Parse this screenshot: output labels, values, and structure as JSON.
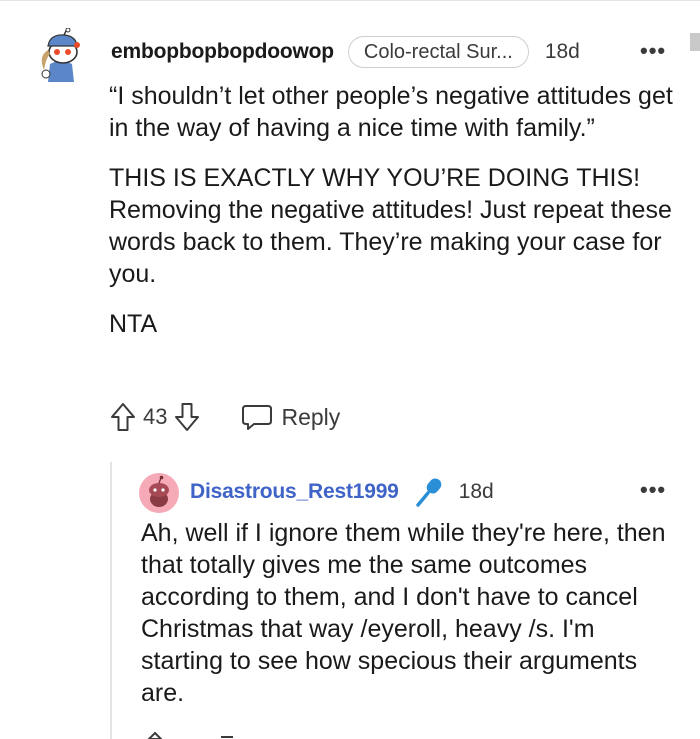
{
  "comment": {
    "username": "embopbopbopdoowop",
    "flair": "Colo-rectal Sur...",
    "time": "18d",
    "more": "•••",
    "paragraphs": [
      "“I shouldn’t let other people’s negative attitudes get in the way of having a nice time with family.”",
      "THIS IS EXACTLY WHY YOU’RE DOING THIS! Removing the negative attitudes! Just repeat these words back to them. They’re making your case for you.",
      "NTA"
    ],
    "score": "43",
    "reply_label": "Reply"
  },
  "reply": {
    "username": "Disastrous_Rest1999",
    "time": "18d",
    "more": "•••",
    "text": "Ah, well if I ignore them while they're here, then that totally gives me the same outcomes according to them, and I don't have to cancel Christmas that way /eyeroll, heavy /s. I'm starting to see how specious their arguments are."
  },
  "colors": {
    "username_reply": "#3f63c7",
    "mic_icon": "#2a8fd6",
    "avatar_reply_bg": "#f6a9b6",
    "avatar_parent_hat": "#5b86c7",
    "text_primary": "#1a1a1b",
    "text_meta": "#3b3b3b"
  },
  "icons": {
    "parent_avatar": "snoo-avatar-icon",
    "reply_avatar": "snoo-avatar-icon",
    "upvote": "arrow-up-icon",
    "downvote": "arrow-down-icon",
    "reply": "speech-bubble-icon",
    "badge": "microphone-icon"
  }
}
